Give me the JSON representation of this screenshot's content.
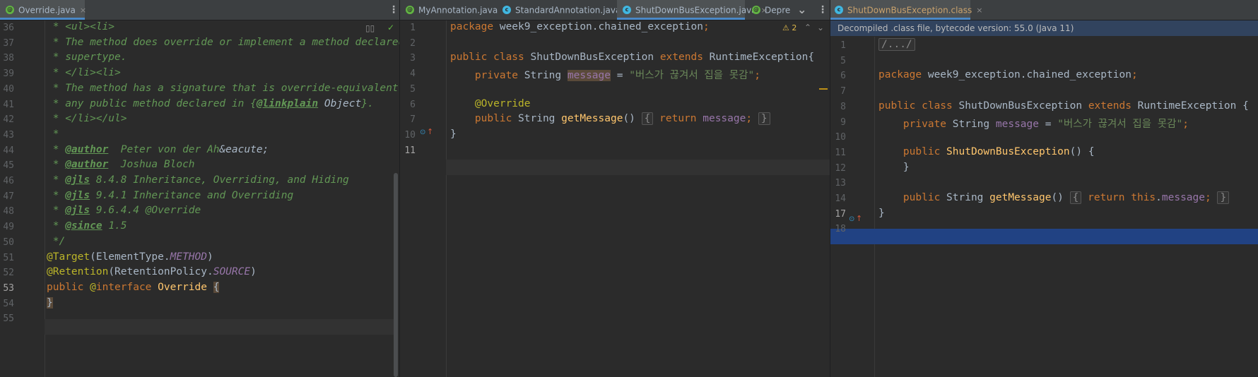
{
  "pane1": {
    "tabs": [
      {
        "label": "Override.java",
        "close": "×"
      }
    ],
    "more": "⋮",
    "lines": [
      {
        "num": "36",
        "segs": [
          {
            "c": "cm",
            "t": " * <ul><li>"
          }
        ]
      },
      {
        "num": "37",
        "segs": [
          {
            "c": "cm",
            "t": " * The method does override or implement a method declared"
          }
        ]
      },
      {
        "num": "38",
        "segs": [
          {
            "c": "cm",
            "t": " * supertype."
          }
        ]
      },
      {
        "num": "39",
        "segs": [
          {
            "c": "cm",
            "t": " * </li><li>"
          }
        ]
      },
      {
        "num": "40",
        "segs": [
          {
            "c": "cm",
            "t": " * The method has a signature that is override-equivalent t"
          }
        ]
      },
      {
        "num": "41",
        "segs": [
          {
            "c": "cm",
            "t": " * any public method declared in {"
          },
          {
            "c": "tag",
            "t": "@linkplain"
          },
          {
            "c": "ref",
            "t": " Object"
          },
          {
            "c": "cm",
            "t": "}."
          }
        ]
      },
      {
        "num": "42",
        "segs": [
          {
            "c": "cm",
            "t": " * </li></ul>"
          }
        ]
      },
      {
        "num": "43",
        "segs": [
          {
            "c": "cm",
            "t": " *"
          }
        ]
      },
      {
        "num": "44",
        "segs": [
          {
            "c": "cm",
            "t": " * "
          },
          {
            "c": "tag",
            "t": "@author"
          },
          {
            "c": "cm",
            "t": "  Peter von der Ah"
          },
          {
            "c": "ref",
            "t": "&eacute;"
          }
        ]
      },
      {
        "num": "45",
        "segs": [
          {
            "c": "cm",
            "t": " * "
          },
          {
            "c": "tag",
            "t": "@author"
          },
          {
            "c": "cm",
            "t": "  Joshua Bloch"
          }
        ]
      },
      {
        "num": "46",
        "segs": [
          {
            "c": "cm",
            "t": " * "
          },
          {
            "c": "tag",
            "t": "@jls"
          },
          {
            "c": "cm",
            "t": " 8.4.8 Inheritance, Overriding, and Hiding"
          }
        ]
      },
      {
        "num": "47",
        "segs": [
          {
            "c": "cm",
            "t": " * "
          },
          {
            "c": "tag",
            "t": "@jls"
          },
          {
            "c": "cm",
            "t": " 9.4.1 Inheritance and Overriding"
          }
        ]
      },
      {
        "num": "48",
        "segs": [
          {
            "c": "cm",
            "t": " * "
          },
          {
            "c": "tag",
            "t": "@jls"
          },
          {
            "c": "cm",
            "t": " 9.6.4.4 @Override"
          }
        ]
      },
      {
        "num": "49",
        "segs": [
          {
            "c": "cm",
            "t": " * "
          },
          {
            "c": "tag",
            "t": "@since"
          },
          {
            "c": "cm",
            "t": " 1.5"
          }
        ]
      },
      {
        "num": "50",
        "segs": [
          {
            "c": "cm",
            "t": " */"
          }
        ]
      },
      {
        "num": "51",
        "segs": [
          {
            "c": "ann",
            "t": "@Target"
          },
          {
            "c": "",
            "t": "(ElementType."
          },
          {
            "c": "fldi",
            "t": "METHOD"
          },
          {
            "c": "",
            "t": ")"
          }
        ]
      },
      {
        "num": "52",
        "segs": [
          {
            "c": "ann",
            "t": "@Retention"
          },
          {
            "c": "",
            "t": "(RetentionPolicy."
          },
          {
            "c": "fldi",
            "t": "SOURCE"
          },
          {
            "c": "",
            "t": ")"
          }
        ]
      },
      {
        "num": "53",
        "segs": [
          {
            "c": "kw",
            "t": "public "
          },
          {
            "c": "ann",
            "t": "@"
          },
          {
            "c": "kw",
            "t": "interface "
          },
          {
            "c": "fn",
            "t": "Override "
          },
          {
            "c": "hl",
            "t": "{"
          }
        ]
      },
      {
        "num": "54",
        "segs": [
          {
            "c": "hl",
            "t": "}"
          }
        ]
      },
      {
        "num": "55",
        "segs": []
      }
    ]
  },
  "pane2": {
    "tabs": [
      {
        "label": "MyAnnotation.java",
        "close": ""
      },
      {
        "label": "StandardAnnotation.java",
        "close": ""
      },
      {
        "label": "ShutDownBusException.java",
        "close": "×"
      },
      {
        "label": "Depre",
        "close": ""
      }
    ],
    "chevron": "⌄",
    "more": "⋮",
    "warning": "⚠ 2",
    "lines": [
      {
        "num": "1",
        "segs": [
          {
            "c": "kw",
            "t": "package "
          },
          {
            "c": "",
            "t": "week9_exception.chained_exception"
          },
          {
            "c": "kw",
            "t": ";"
          }
        ]
      },
      {
        "num": "2",
        "segs": []
      },
      {
        "num": "3",
        "segs": [
          {
            "c": "kw",
            "t": "public class "
          },
          {
            "c": "",
            "t": "ShutDownBusException "
          },
          {
            "c": "kw",
            "t": "extends "
          },
          {
            "c": "",
            "t": "RuntimeException{"
          }
        ]
      },
      {
        "num": "4",
        "segs": [
          {
            "c": "",
            "t": "    "
          },
          {
            "c": "kw",
            "t": "private "
          },
          {
            "c": "",
            "t": "String "
          },
          {
            "c": "fld hl",
            "t": "message"
          },
          {
            "c": "",
            "t": " = "
          },
          {
            "c": "str",
            "t": "\"버스가 끊겨서 집을 못감\""
          },
          {
            "c": "kw",
            "t": ";"
          }
        ]
      },
      {
        "num": "5",
        "segs": []
      },
      {
        "num": "6",
        "segs": [
          {
            "c": "",
            "t": "    "
          },
          {
            "c": "ann",
            "t": "@Override"
          }
        ]
      },
      {
        "num": "7",
        "segs": [
          {
            "c": "",
            "t": "    "
          },
          {
            "c": "kw",
            "t": "public "
          },
          {
            "c": "",
            "t": "String "
          },
          {
            "c": "fn",
            "t": "getMessage"
          },
          {
            "c": "",
            "t": "() "
          },
          {
            "c": "fold",
            "t": "{"
          },
          {
            "c": "",
            "t": " "
          },
          {
            "c": "kw",
            "t": "return "
          },
          {
            "c": "fld",
            "t": "message"
          },
          {
            "c": "kw",
            "t": ";"
          },
          {
            "c": "",
            "t": " "
          },
          {
            "c": "fold",
            "t": "}"
          }
        ]
      },
      {
        "num": "10",
        "segs": [
          {
            "c": "",
            "t": "}"
          }
        ]
      },
      {
        "num": "11",
        "segs": []
      }
    ]
  },
  "pane3": {
    "tabs": [
      {
        "label": "ShutDownBusException.class",
        "close": "×"
      }
    ],
    "banner": "Decompiled .class file, bytecode version: 55.0 (Java 11)",
    "lines": [
      {
        "num": "1",
        "segs": [
          {
            "c": "fold",
            "t": "/.../"
          }
        ]
      },
      {
        "num": "5",
        "segs": []
      },
      {
        "num": "6",
        "segs": [
          {
            "c": "kw",
            "t": "package "
          },
          {
            "c": "",
            "t": "week9_exception.chained_exception"
          },
          {
            "c": "kw",
            "t": ";"
          }
        ]
      },
      {
        "num": "7",
        "segs": []
      },
      {
        "num": "8",
        "segs": [
          {
            "c": "kw",
            "t": "public class "
          },
          {
            "c": "",
            "t": "ShutDownBusException "
          },
          {
            "c": "kw",
            "t": "extends "
          },
          {
            "c": "",
            "t": "RuntimeException {"
          }
        ]
      },
      {
        "num": "9",
        "segs": [
          {
            "c": "",
            "t": "    "
          },
          {
            "c": "kw",
            "t": "private "
          },
          {
            "c": "",
            "t": "String "
          },
          {
            "c": "fld",
            "t": "message"
          },
          {
            "c": "",
            "t": " = "
          },
          {
            "c": "str",
            "t": "\"버스가 끊겨서 집을 못감\""
          },
          {
            "c": "kw",
            "t": ";"
          }
        ]
      },
      {
        "num": "10",
        "segs": []
      },
      {
        "num": "11",
        "segs": [
          {
            "c": "",
            "t": "    "
          },
          {
            "c": "kw",
            "t": "public "
          },
          {
            "c": "fn",
            "t": "ShutDownBusException"
          },
          {
            "c": "",
            "t": "() {"
          }
        ]
      },
      {
        "num": "12",
        "segs": [
          {
            "c": "",
            "t": "    }"
          }
        ]
      },
      {
        "num": "13",
        "segs": []
      },
      {
        "num": "14",
        "segs": [
          {
            "c": "",
            "t": "    "
          },
          {
            "c": "kw",
            "t": "public "
          },
          {
            "c": "",
            "t": "String "
          },
          {
            "c": "fn",
            "t": "getMessage"
          },
          {
            "c": "",
            "t": "() "
          },
          {
            "c": "fold",
            "t": "{"
          },
          {
            "c": "",
            "t": " "
          },
          {
            "c": "kw",
            "t": "return this"
          },
          {
            "c": "",
            "t": "."
          },
          {
            "c": "fld",
            "t": "message"
          },
          {
            "c": "kw",
            "t": ";"
          },
          {
            "c": "",
            "t": " "
          },
          {
            "c": "fold",
            "t": "}"
          }
        ]
      },
      {
        "num": "17",
        "segs": [
          {
            "c": "",
            "t": "}"
          }
        ]
      },
      {
        "num": "18",
        "segs": []
      }
    ]
  }
}
